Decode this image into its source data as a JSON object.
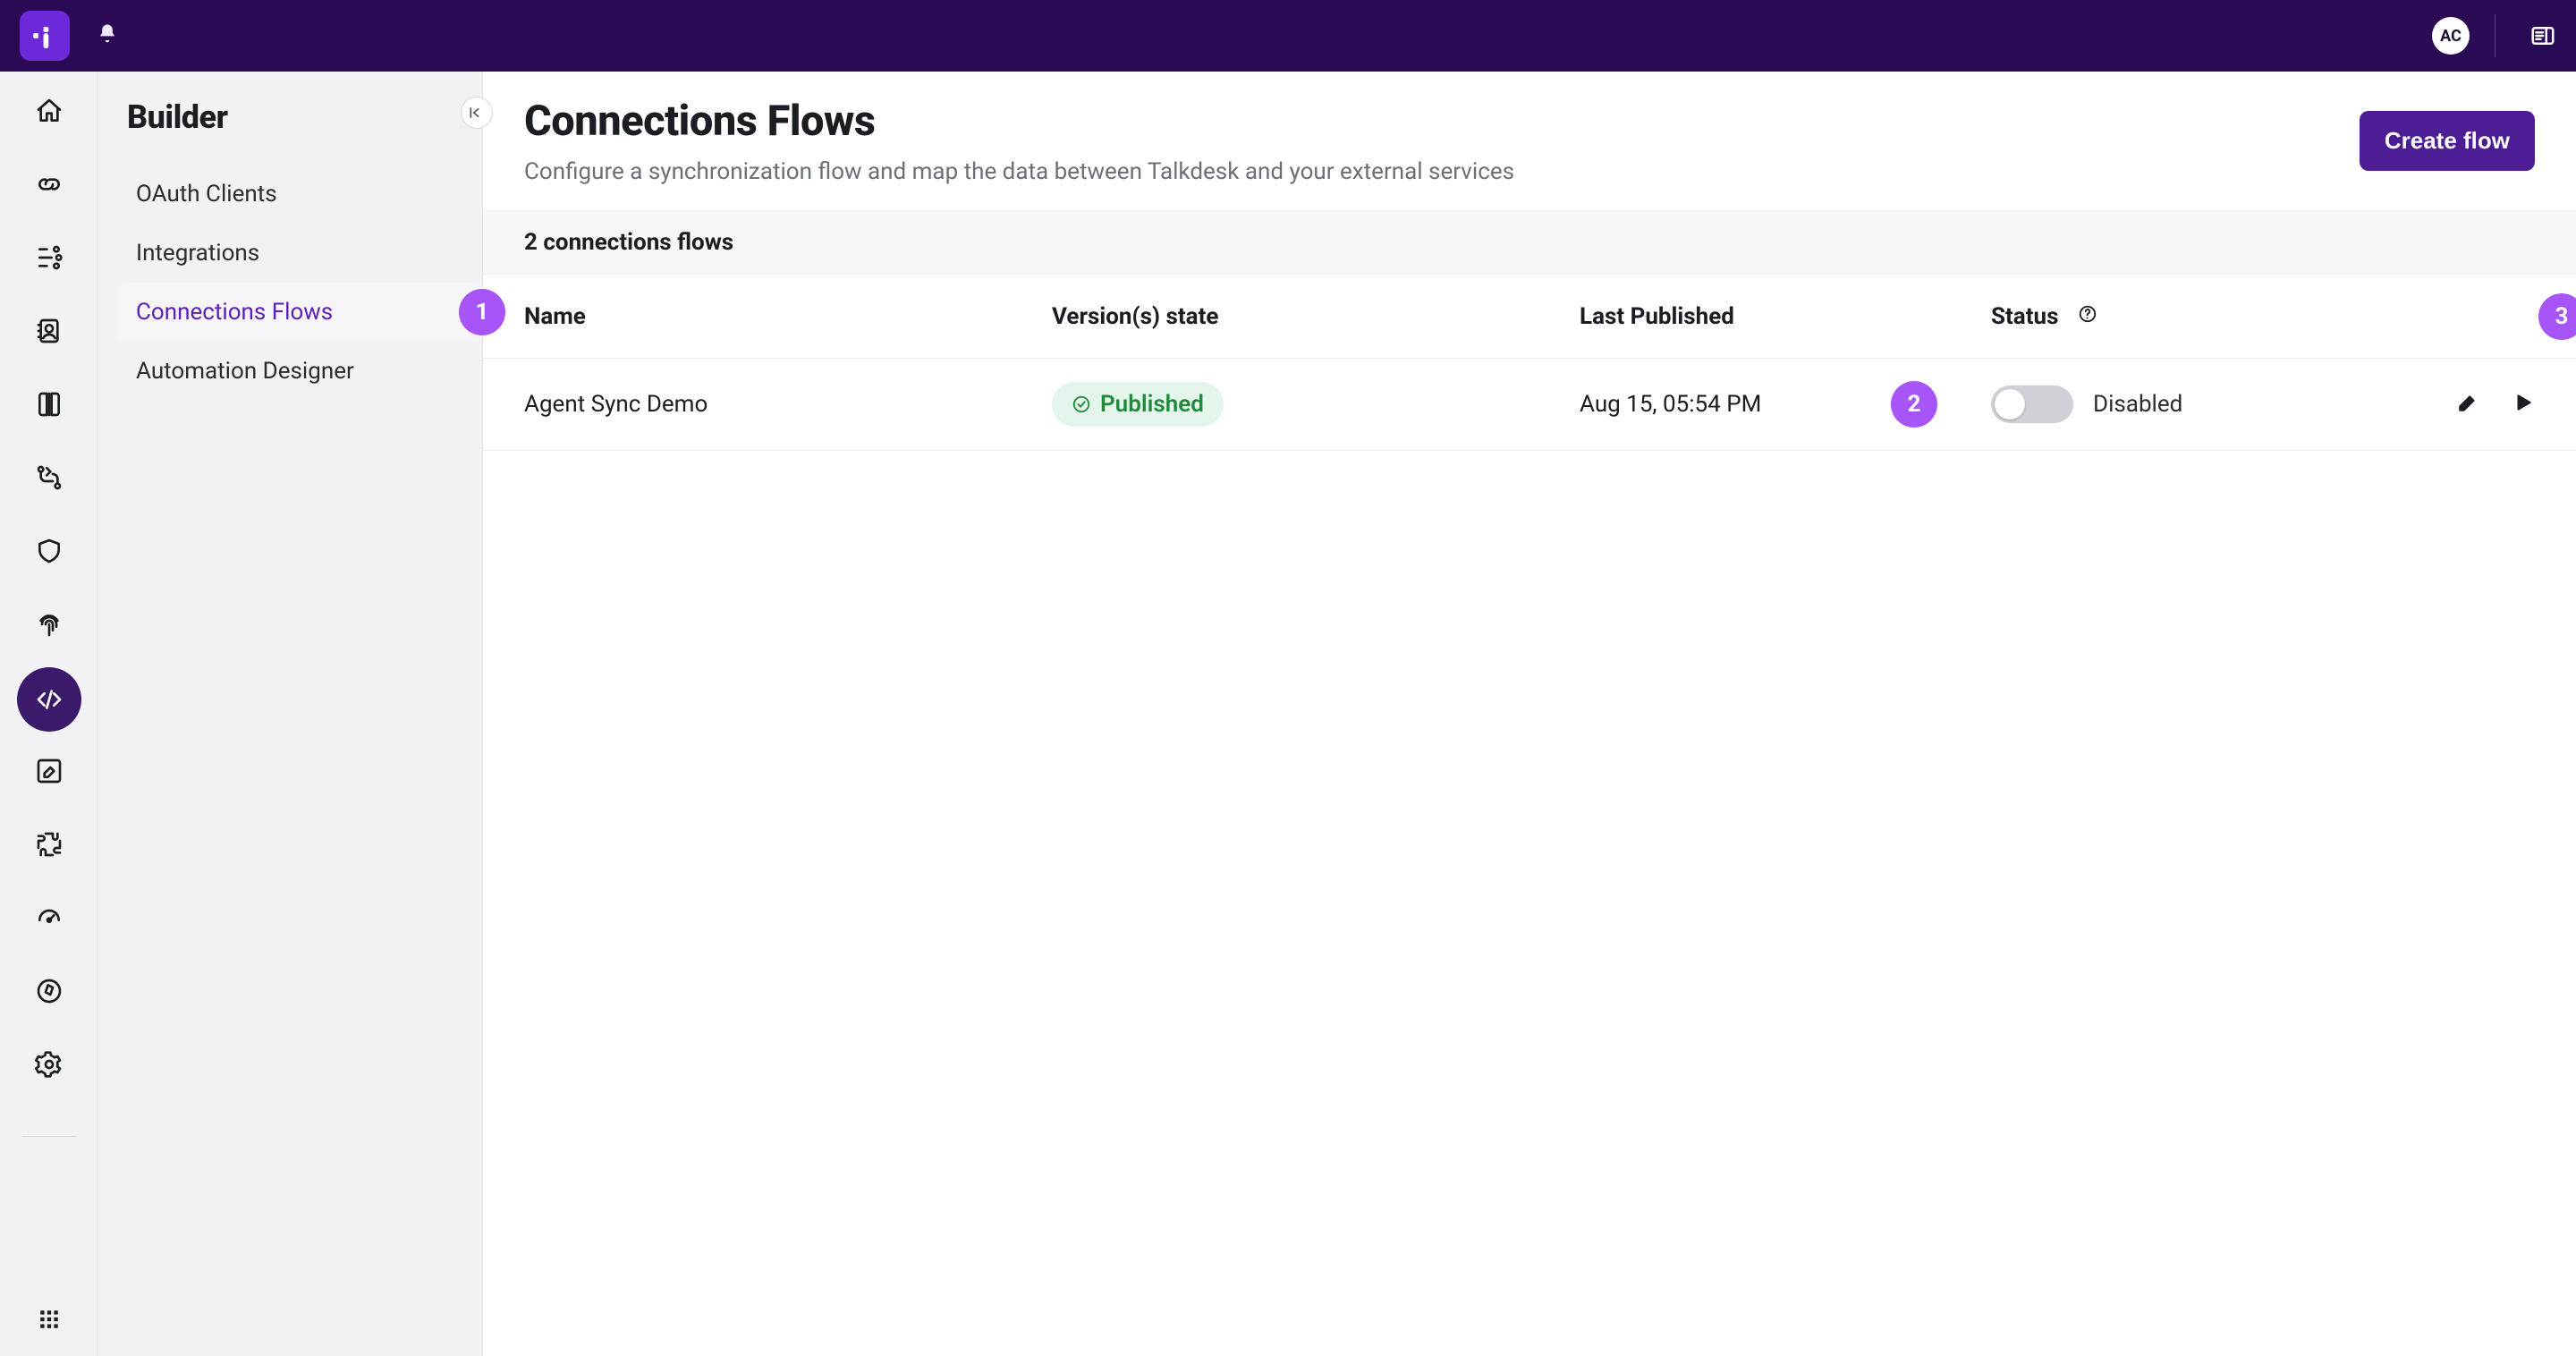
{
  "header": {
    "avatar_initials": "AC"
  },
  "rail": {
    "items": [
      "home",
      "link",
      "steps",
      "address-book",
      "book",
      "routing",
      "shield",
      "fingerprint",
      "code",
      "edit",
      "integrations",
      "dashboard",
      "compass",
      "gear"
    ]
  },
  "sidebar": {
    "title": "Builder",
    "items": [
      {
        "label": "OAuth Clients"
      },
      {
        "label": "Integrations"
      },
      {
        "label": "Connections Flows",
        "active": true
      },
      {
        "label": "Automation Designer"
      }
    ]
  },
  "page": {
    "title": "Connections Flows",
    "subtitle": "Configure a synchronization flow and map the data between Talkdesk and your external services",
    "create_button": "Create flow"
  },
  "filter": {
    "count_label": "2 connections flows"
  },
  "table": {
    "columns": {
      "name": "Name",
      "state": "Version(s) state",
      "last_published": "Last Published",
      "status": "Status"
    },
    "rows": [
      {
        "name": "Agent Sync Demo",
        "state_badge": "Published",
        "last_published": "Aug 15, 05:54 PM",
        "status_label": "Disabled",
        "enabled": false
      }
    ]
  },
  "callouts": {
    "c1": "1",
    "c2": "2",
    "c3": "3"
  }
}
